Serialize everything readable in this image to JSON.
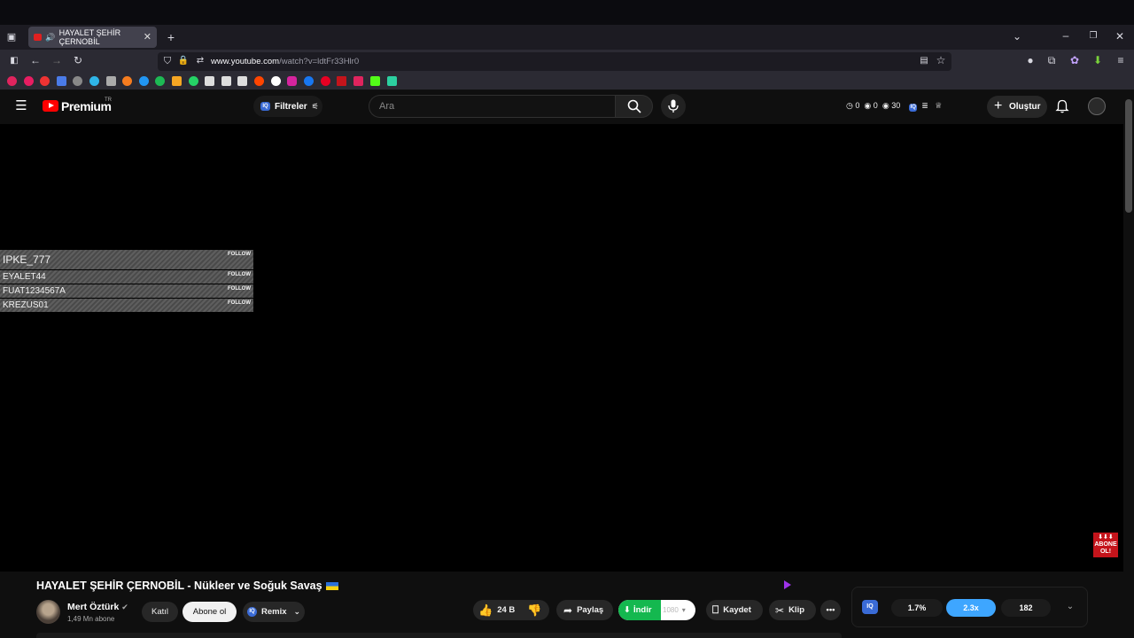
{
  "browser": {
    "tab_title": "HAYALET ŞEHİR ÇERNOBİL",
    "url_domain": "www.youtube.com",
    "url_path": "/watch?v=ldtFr33Hlr0"
  },
  "header": {
    "logo_text": "Premium",
    "logo_region": "TR",
    "filters_label": "Filtreler",
    "search_placeholder": "Ara",
    "stat1": "0",
    "stat2": "0",
    "stat3": "30",
    "create_label": "Oluştur"
  },
  "overlay": {
    "rows": [
      {
        "name": "IPKE_777",
        "follow": "FOLLOW"
      },
      {
        "name": "EYALET44",
        "follow": "FOLLOW"
      },
      {
        "name": "FUAT1234567A",
        "follow": "FOLLOW"
      },
      {
        "name": "KREZUS01",
        "follow": "FOLLOW"
      }
    ],
    "subscribe_badge_line1": "ABONE",
    "subscribe_badge_line2": "OL!"
  },
  "video": {
    "title": "HAYALET ŞEHİR ÇERNOBİL - Nükleer ve Soğuk Savaş",
    "channel_name": "Mert Öztürk",
    "channel_subs": "1,49 Mn abone",
    "join_label": "Katıl",
    "subscribe_label": "Abone ol",
    "remix_label": "Remix",
    "likes": "24 B",
    "share_label": "Paylaş",
    "download_label": "İndir",
    "download_quality": "1080",
    "save_label": "Kaydet",
    "clip_label": "Klip"
  },
  "controls": {
    "val1": "1.7%",
    "val2": "2.3x",
    "val3": "182"
  },
  "colors": {
    "accent_red": "#ff0000",
    "download_green": "#14b84f",
    "speed_blue": "#3ea6ff"
  }
}
